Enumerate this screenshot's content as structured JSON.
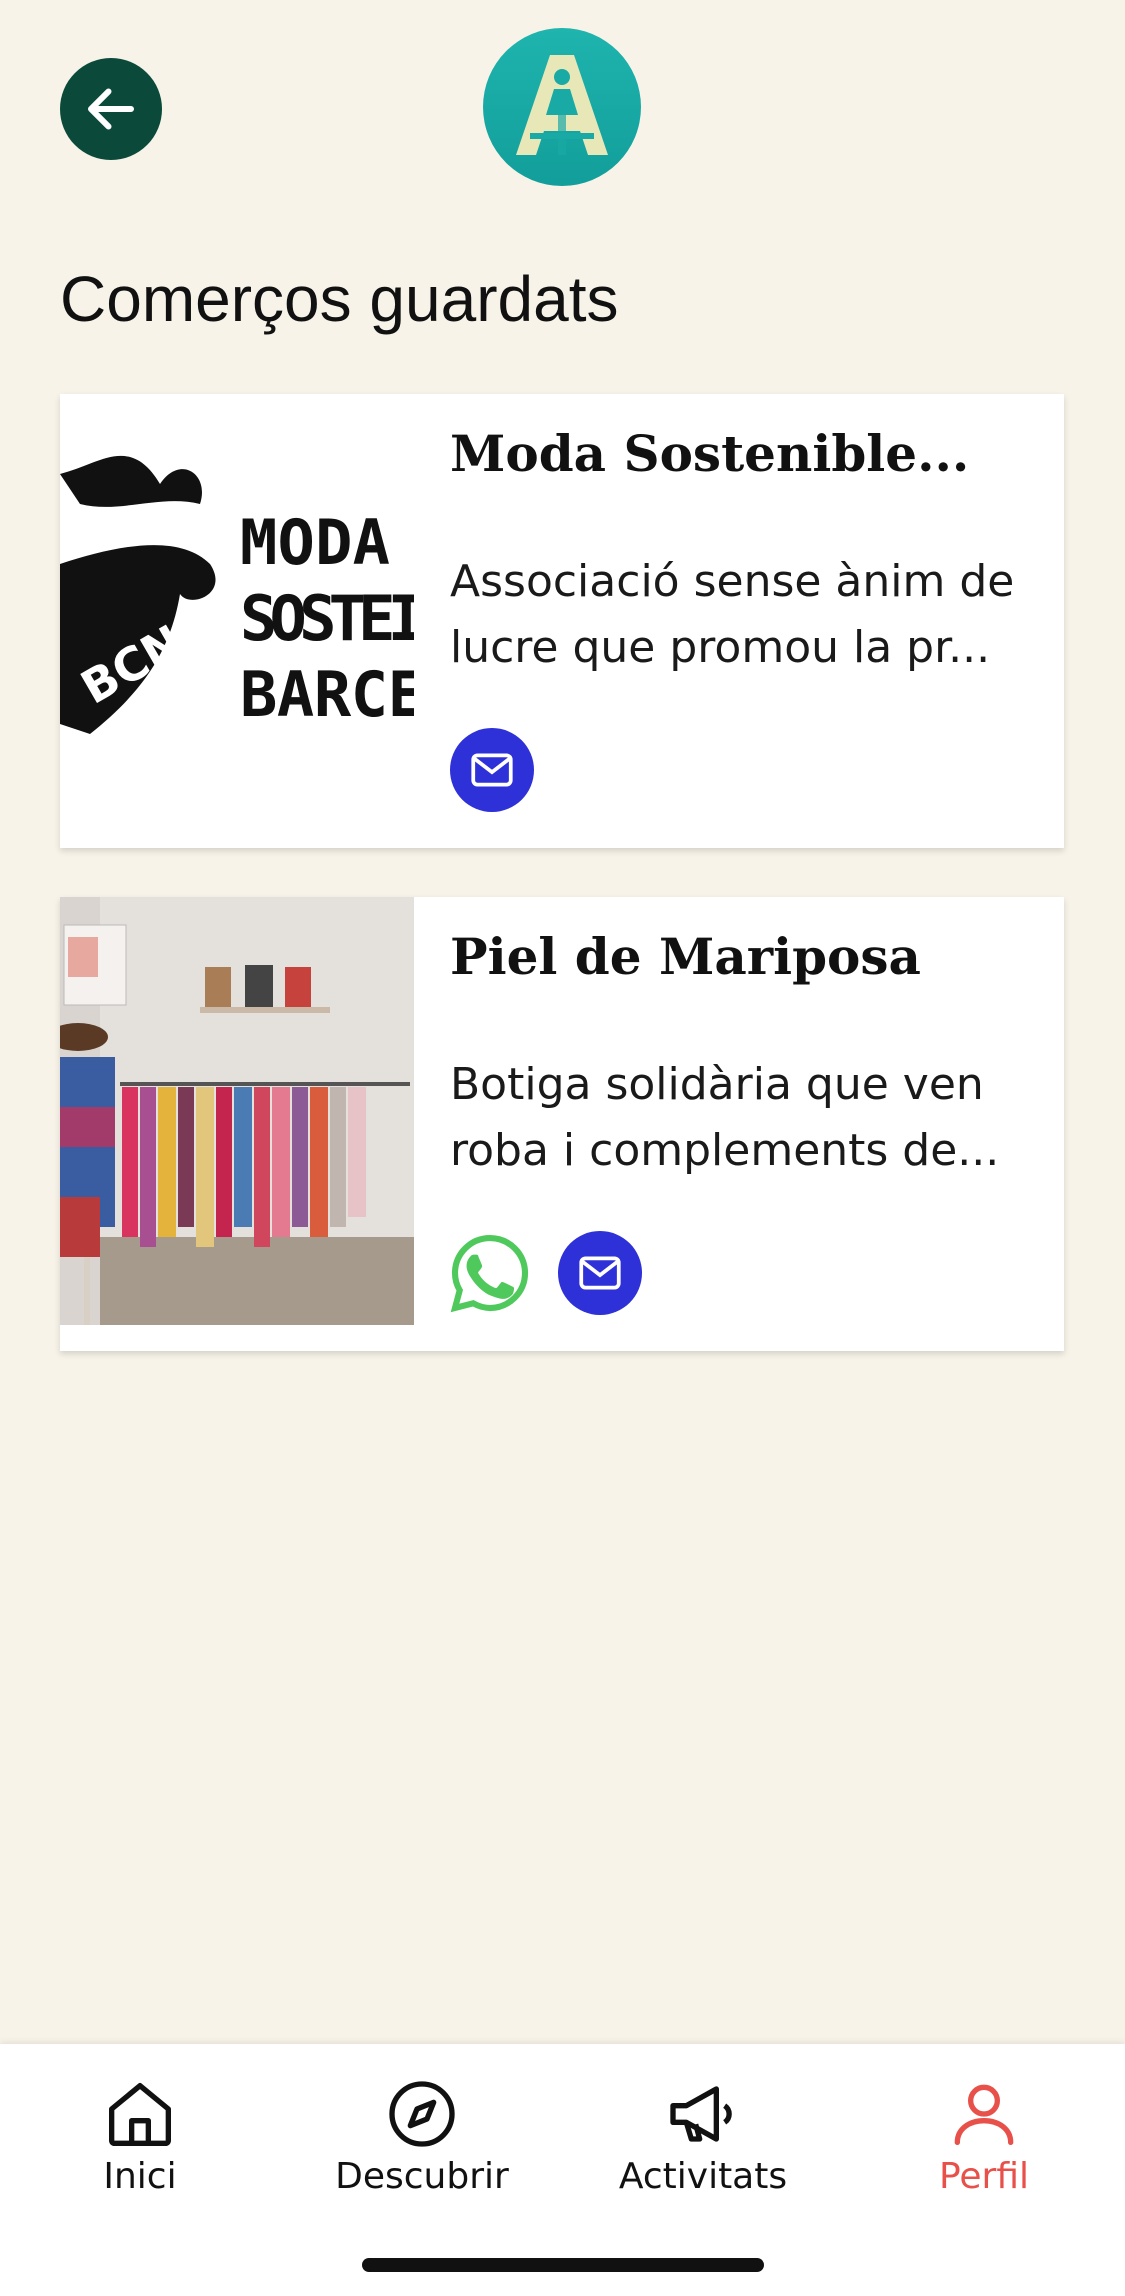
{
  "header": {
    "back_icon": "arrow-left-icon",
    "logo_icon": "app-logo-a-icon",
    "title": "Comerços guardats"
  },
  "colors": {
    "background": "#f7f3e9",
    "back_button": "#0b4a3a",
    "logo": "#1fb4ae",
    "mail_button": "#2e30d8",
    "whatsapp": "#4fc95c",
    "active_tab": "#e8504a"
  },
  "saved_shops": [
    {
      "title": "Moda Sostenible...",
      "desc_line1": "Associació sense ànim de",
      "desc_line2": "lucre que promou la pr...",
      "image_text": [
        "MODA",
        "SOSTEI",
        "BARCE"
      ],
      "image_badge": "BCN",
      "actions": [
        "mail-icon"
      ]
    },
    {
      "title": "Piel de Mariposa",
      "desc_line1": "Botiga solidària que ven",
      "desc_line2": "roba i complements de...",
      "actions": [
        "whatsapp-icon",
        "mail-icon"
      ]
    }
  ],
  "bottom_nav": [
    {
      "label": "Inici",
      "icon": "home-icon",
      "active": false
    },
    {
      "label": "Descubrir",
      "icon": "compass-icon",
      "active": false
    },
    {
      "label": "Activitats",
      "icon": "megaphone-icon",
      "active": false
    },
    {
      "label": "Perfil",
      "icon": "user-icon",
      "active": true
    }
  ]
}
